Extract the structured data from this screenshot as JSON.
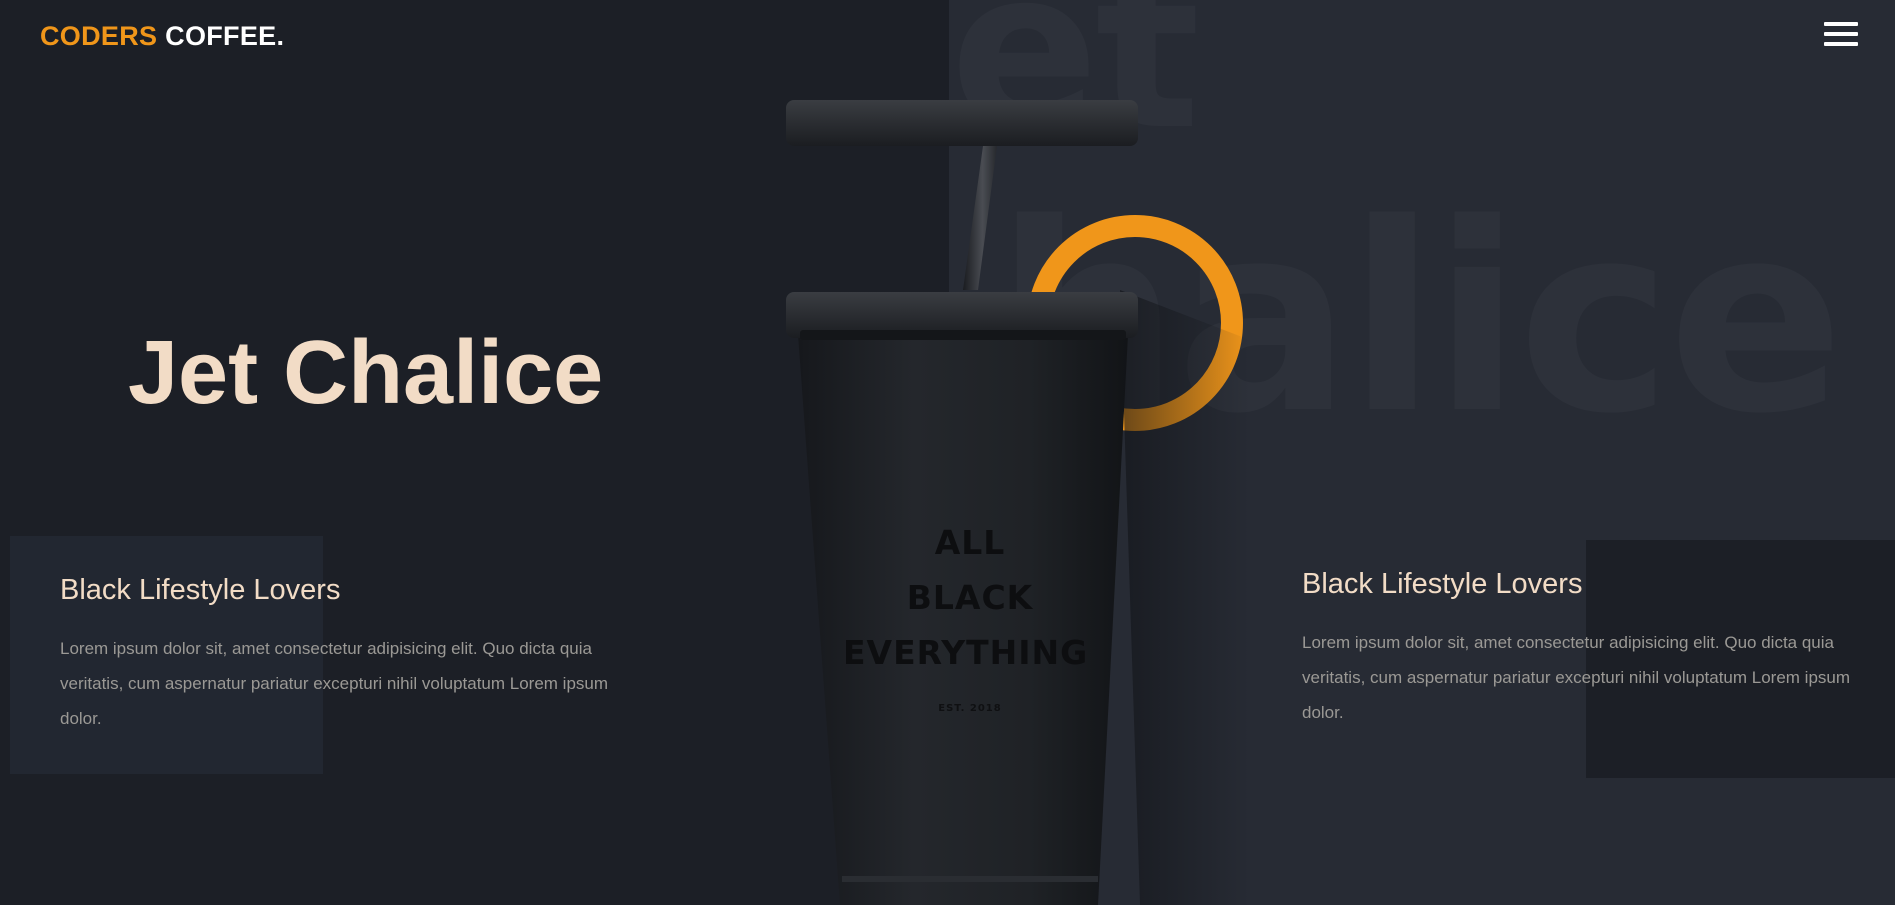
{
  "brand": {
    "accent": "CODERS",
    "name": "COFFEE."
  },
  "nav": {
    "menu_icon": "hamburger-menu-icon"
  },
  "hero": {
    "title": "Jet Chalice",
    "background_word_1": "et",
    "background_word_2": "halice"
  },
  "product": {
    "cup_line_1": "ALL",
    "cup_line_2": "BLACK",
    "cup_line_3": "EVERYTHING",
    "cup_est": "EST. 2018"
  },
  "features": [
    {
      "title": "Black Lifestyle Lovers",
      "text": "Lorem ipsum dolor sit, amet consectetur adipisicing elit. Quo dicta quia veritatis, cum aspernatur pariatur excepturi nihil voluptatum Lorem ipsum dolor."
    },
    {
      "title": "Black Lifestyle Lovers",
      "text": "Lorem ipsum dolor sit, amet consectetur adipisicing elit. Quo dicta quia veritatis, cum aspernatur pariatur excepturi nihil voluptatum Lorem ipsum dolor."
    }
  ],
  "colors": {
    "accent": "#f0961a",
    "title": "#f2dcc6",
    "background_dark": "#1c1f26",
    "background_panel": "#272b34",
    "body_text": "#9b9995"
  }
}
